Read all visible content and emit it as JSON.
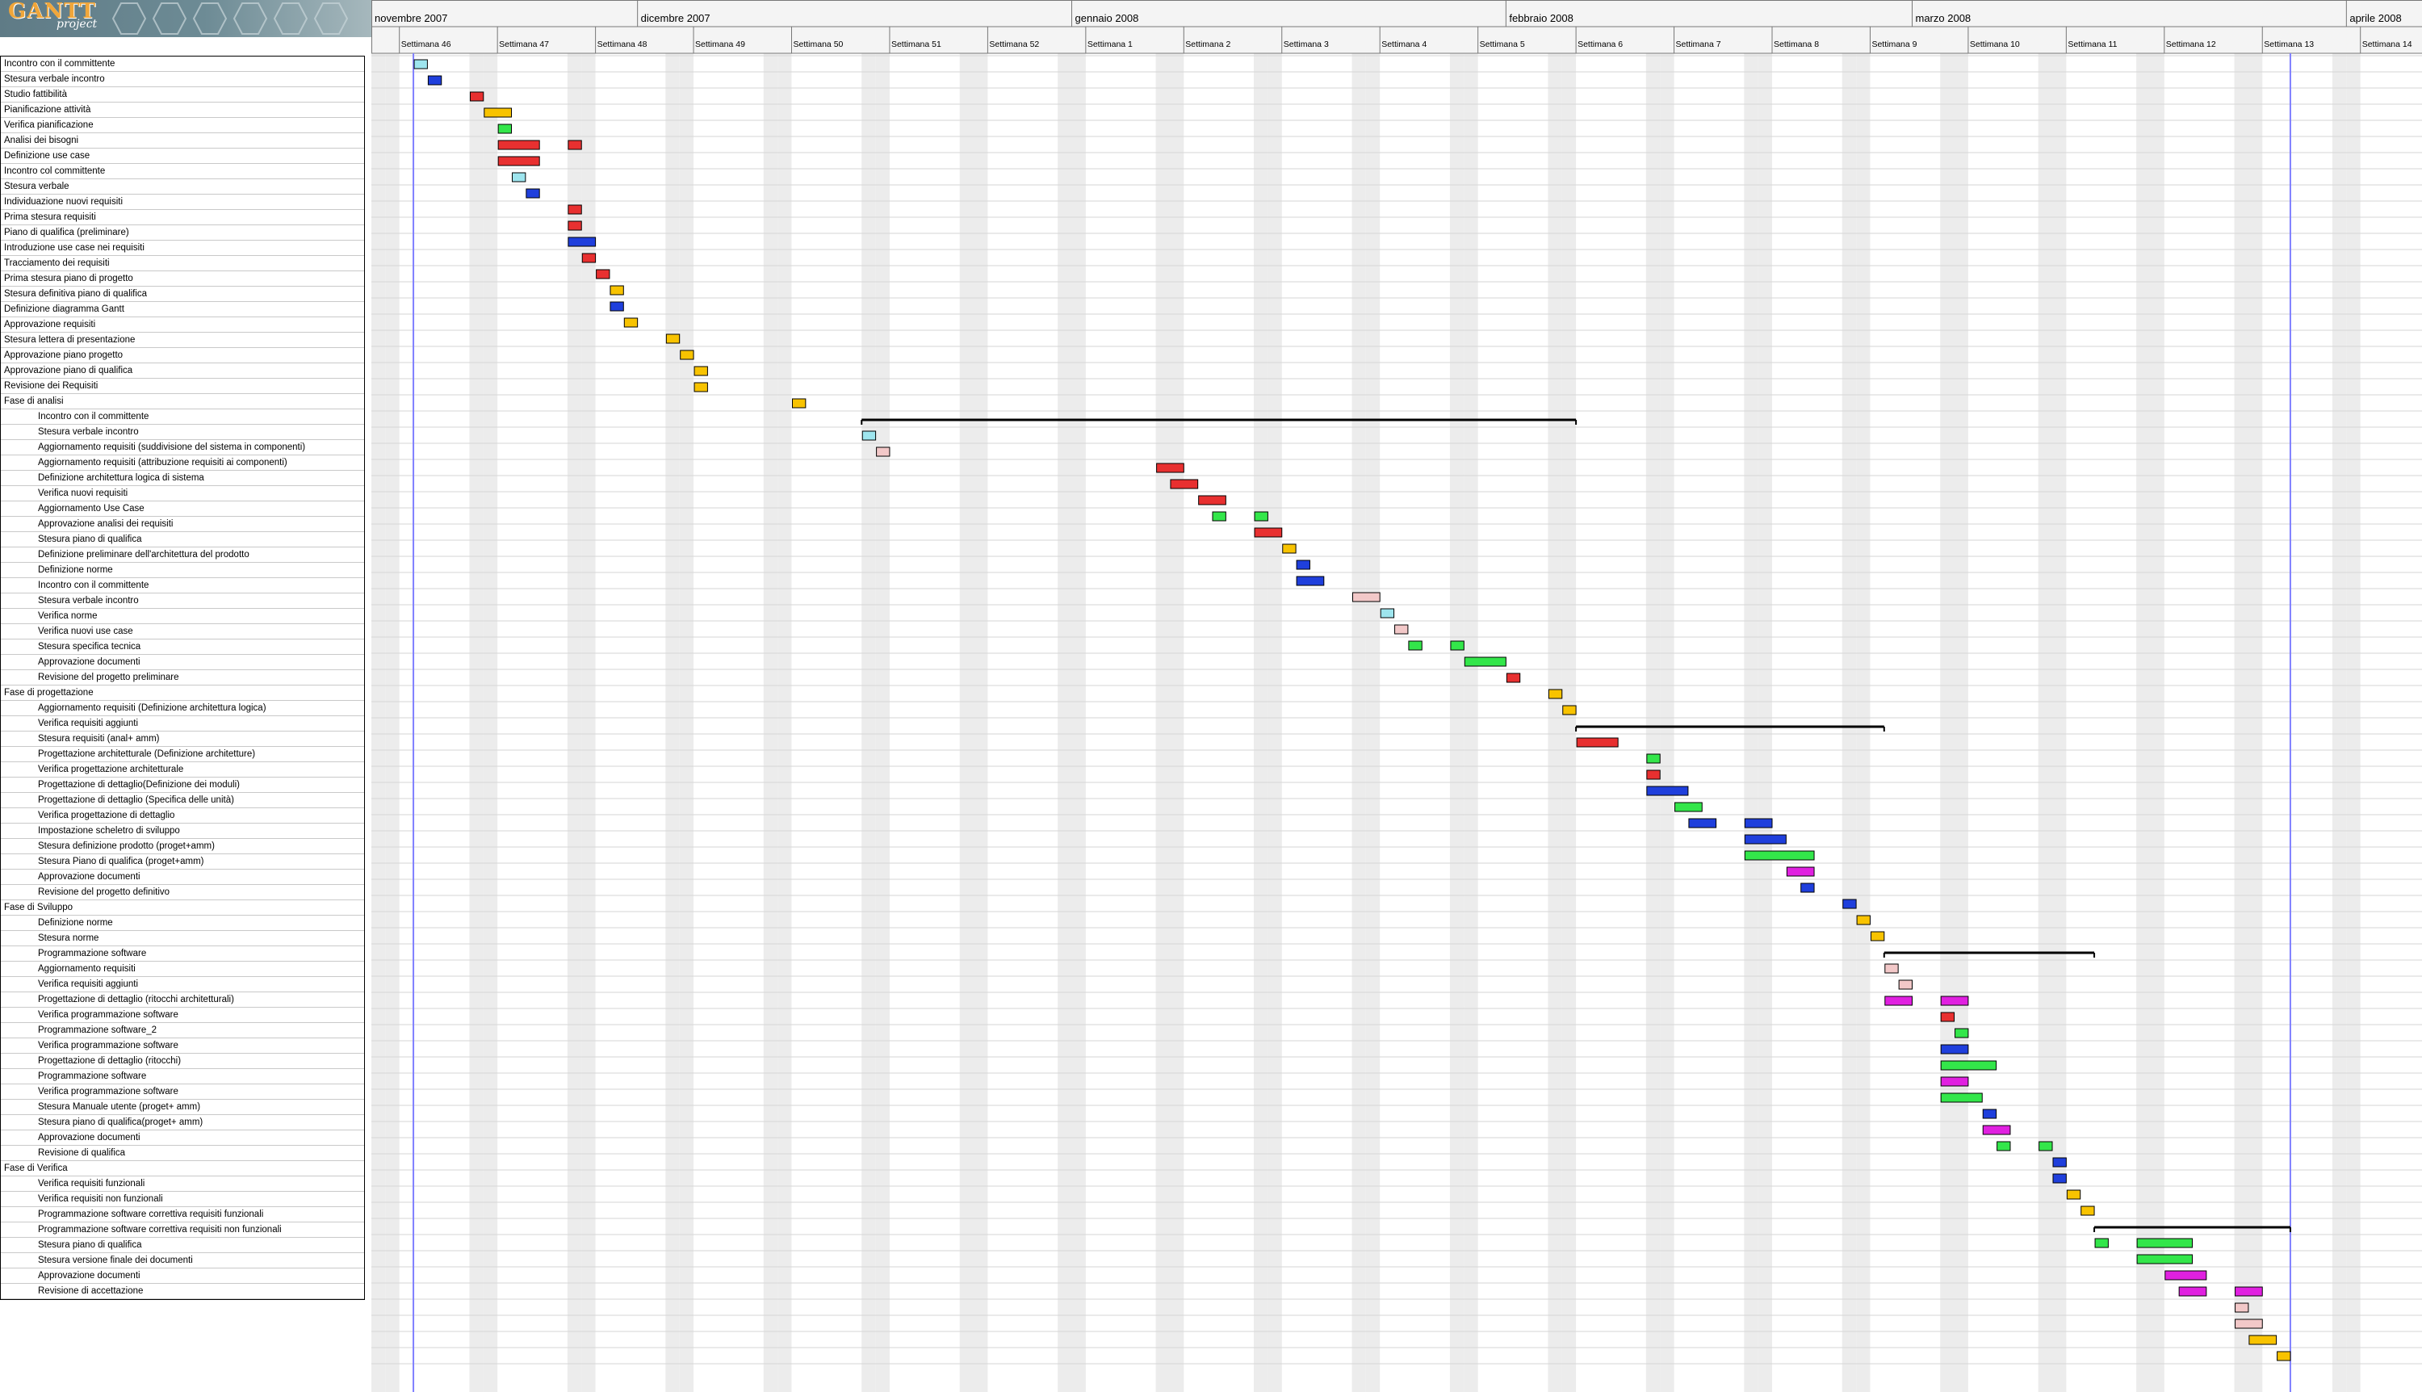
{
  "app": {
    "logo_text": "GANTT",
    "logo_sub": "project"
  },
  "colors": {
    "cyan": "#9ee5ee",
    "blue": "#1f3fdc",
    "red": "#e83030",
    "yellow": "#f8c300",
    "green": "#33e64a",
    "pink": "#f2c8c8",
    "magenta": "#e020e0",
    "weekend": "#ececec",
    "today_line": "#8080ff"
  },
  "timeline": {
    "months": [
      {
        "label": "novembre 2007"
      },
      {
        "label": "dicembre 2007"
      },
      {
        "label": "gennaio 2008"
      },
      {
        "label": "febbraio 2008"
      },
      {
        "label": "marzo 2008"
      },
      {
        "label": "aprile 2008"
      }
    ],
    "weeks": [
      "Settimana 46",
      "Settimana 47",
      "Settimana 48",
      "Settimana 49",
      "Settimana 50",
      "Settimana 51",
      "Settimana 52",
      "Settimana 1",
      "Settimana 2",
      "Settimana 3",
      "Settimana 4",
      "Settimana 5",
      "Settimana 6",
      "Settimana 7",
      "Settimana 8",
      "Settimana 9",
      "Settimana 10",
      "Settimana 11",
      "Settimana 12",
      "Settimana 13",
      "Settimana 14"
    ]
  },
  "tasks": [
    {
      "name": "Incontro con il committente",
      "level": 1,
      "bars": [
        {
          "s": 3,
          "e": 4,
          "c": "cyan"
        }
      ]
    },
    {
      "name": "Stesura verbale incontro",
      "level": 1,
      "bars": [
        {
          "s": 4,
          "e": 5,
          "c": "blue"
        }
      ]
    },
    {
      "name": "Studio fattibilità",
      "level": 1,
      "bars": [
        {
          "s": 7,
          "e": 8,
          "c": "red"
        }
      ]
    },
    {
      "name": "Pianificazione attività",
      "level": 1,
      "bars": [
        {
          "s": 8,
          "e": 10,
          "c": "yellow"
        }
      ]
    },
    {
      "name": "Verifica pianificazione",
      "level": 1,
      "bars": [
        {
          "s": 9,
          "e": 10,
          "c": "green"
        }
      ]
    },
    {
      "name": "Analisi dei bisogni",
      "level": 1,
      "bars": [
        {
          "s": 9,
          "e": 12,
          "c": "red"
        },
        {
          "s": 14,
          "e": 15,
          "c": "red"
        }
      ]
    },
    {
      "name": "Definizione use case",
      "level": 1,
      "bars": [
        {
          "s": 9,
          "e": 12,
          "c": "red"
        }
      ]
    },
    {
      "name": "Incontro col committente",
      "level": 1,
      "bars": [
        {
          "s": 10,
          "e": 11,
          "c": "cyan"
        }
      ]
    },
    {
      "name": "Stesura verbale",
      "level": 1,
      "bars": [
        {
          "s": 11,
          "e": 12,
          "c": "blue"
        }
      ]
    },
    {
      "name": "Individuazione nuovi requisiti",
      "level": 1,
      "bars": [
        {
          "s": 14,
          "e": 15,
          "c": "red"
        }
      ]
    },
    {
      "name": "Prima stesura requisiti",
      "level": 1,
      "bars": [
        {
          "s": 14,
          "e": 15,
          "c": "red"
        }
      ]
    },
    {
      "name": "Piano di qualifica (preliminare)",
      "level": 1,
      "bars": [
        {
          "s": 14,
          "e": 16,
          "c": "blue"
        }
      ]
    },
    {
      "name": "Introduzione use case nei requisiti",
      "level": 1,
      "bars": [
        {
          "s": 15,
          "e": 16,
          "c": "red"
        }
      ]
    },
    {
      "name": "Tracciamento dei requisiti",
      "level": 1,
      "bars": [
        {
          "s": 16,
          "e": 17,
          "c": "red"
        }
      ]
    },
    {
      "name": "Prima stesura piano di progetto",
      "level": 1,
      "bars": [
        {
          "s": 17,
          "e": 18,
          "c": "yellow"
        }
      ]
    },
    {
      "name": "Stesura definitiva piano di qualifica",
      "level": 1,
      "bars": [
        {
          "s": 17,
          "e": 18,
          "c": "blue"
        }
      ]
    },
    {
      "name": "Definizione diagramma Gantt",
      "level": 1,
      "bars": [
        {
          "s": 18,
          "e": 19,
          "c": "yellow"
        }
      ]
    },
    {
      "name": "Approvazione requisiti",
      "level": 1,
      "bars": [
        {
          "s": 21,
          "e": 22,
          "c": "yellow"
        }
      ]
    },
    {
      "name": "Stesura lettera di presentazione",
      "level": 1,
      "bars": [
        {
          "s": 22,
          "e": 23,
          "c": "yellow"
        }
      ]
    },
    {
      "name": "Approvazione piano progetto",
      "level": 1,
      "bars": [
        {
          "s": 23,
          "e": 24,
          "c": "yellow"
        }
      ]
    },
    {
      "name": "Approvazione piano di qualifica",
      "level": 1,
      "bars": [
        {
          "s": 23,
          "e": 24,
          "c": "yellow"
        }
      ]
    },
    {
      "name": "Revisione dei Requisiti",
      "level": 1,
      "bars": [
        {
          "s": 30,
          "e": 31,
          "c": "yellow"
        }
      ]
    },
    {
      "name": "Fase di analisi",
      "level": 1,
      "summary": {
        "s": 35,
        "e": 86
      }
    },
    {
      "name": "Incontro con il committente",
      "level": 2,
      "bars": [
        {
          "s": 35,
          "e": 36,
          "c": "cyan"
        }
      ]
    },
    {
      "name": "Stesura verbale incontro",
      "level": 2,
      "bars": [
        {
          "s": 36,
          "e": 37,
          "c": "pink"
        }
      ]
    },
    {
      "name": "Aggiornamento requisiti (suddivisione del sistema in componenti)",
      "level": 2,
      "bars": [
        {
          "s": 56,
          "e": 58,
          "c": "red"
        }
      ]
    },
    {
      "name": "Aggiornamento requisiti (attribuzione requisiti ai componenti)",
      "level": 2,
      "bars": [
        {
          "s": 57,
          "e": 59,
          "c": "red"
        }
      ]
    },
    {
      "name": "Definizione architettura logica di sistema",
      "level": 2,
      "bars": [
        {
          "s": 59,
          "e": 61,
          "c": "red"
        }
      ]
    },
    {
      "name": "Verifica nuovi requisiti",
      "level": 2,
      "bars": [
        {
          "s": 60,
          "e": 61,
          "c": "green"
        },
        {
          "s": 63,
          "e": 64,
          "c": "green"
        }
      ]
    },
    {
      "name": "Aggiornamento Use Case",
      "level": 2,
      "bars": [
        {
          "s": 63,
          "e": 65,
          "c": "red"
        }
      ]
    },
    {
      "name": "Approvazione analisi dei requisiti",
      "level": 2,
      "bars": [
        {
          "s": 65,
          "e": 66,
          "c": "yellow"
        }
      ]
    },
    {
      "name": "Stesura piano di qualifica",
      "level": 2,
      "bars": [
        {
          "s": 66,
          "e": 67,
          "c": "blue"
        }
      ]
    },
    {
      "name": "Definizione preliminare dell'architettura del prodotto",
      "level": 2,
      "bars": [
        {
          "s": 66,
          "e": 68,
          "c": "blue"
        }
      ]
    },
    {
      "name": "Definizione norme",
      "level": 2,
      "bars": [
        {
          "s": 70,
          "e": 72,
          "c": "pink"
        }
      ]
    },
    {
      "name": "Incontro con il committente",
      "level": 2,
      "bars": [
        {
          "s": 72,
          "e": 73,
          "c": "cyan"
        }
      ]
    },
    {
      "name": "Stesura verbale incontro",
      "level": 2,
      "bars": [
        {
          "s": 73,
          "e": 74,
          "c": "pink"
        }
      ]
    },
    {
      "name": "Verifica norme",
      "level": 2,
      "bars": [
        {
          "s": 74,
          "e": 75,
          "c": "green"
        },
        {
          "s": 77,
          "e": 78,
          "c": "green"
        }
      ]
    },
    {
      "name": "Verifica nuovi use case",
      "level": 2,
      "bars": [
        {
          "s": 78,
          "e": 81,
          "c": "green"
        }
      ]
    },
    {
      "name": "Stesura specifica tecnica",
      "level": 2,
      "bars": [
        {
          "s": 81,
          "e": 82,
          "c": "red"
        }
      ]
    },
    {
      "name": "Approvazione documenti",
      "level": 2,
      "bars": [
        {
          "s": 84,
          "e": 85,
          "c": "yellow"
        }
      ]
    },
    {
      "name": "Revisione del progetto preliminare",
      "level": 2,
      "bars": [
        {
          "s": 85,
          "e": 86,
          "c": "yellow"
        }
      ]
    },
    {
      "name": "Fase di progettazione",
      "level": 1,
      "summary": {
        "s": 86,
        "e": 108
      }
    },
    {
      "name": "Aggiornamento requisiti (Definizione architettura logica)",
      "level": 2,
      "bars": [
        {
          "s": 86,
          "e": 89,
          "c": "red"
        }
      ]
    },
    {
      "name": "Verifica requisiti aggiunti",
      "level": 2,
      "bars": [
        {
          "s": 91,
          "e": 92,
          "c": "green"
        }
      ]
    },
    {
      "name": "Stesura requisiti (anal+ amm)",
      "level": 2,
      "bars": [
        {
          "s": 91,
          "e": 92,
          "c": "red"
        }
      ]
    },
    {
      "name": "Progettazione architetturale (Definizione architetture)",
      "level": 2,
      "bars": [
        {
          "s": 91,
          "e": 94,
          "c": "blue"
        }
      ]
    },
    {
      "name": "Verifica progettazione architetturale",
      "level": 2,
      "bars": [
        {
          "s": 93,
          "e": 95,
          "c": "green"
        }
      ]
    },
    {
      "name": "Progettazione di dettaglio(Definizione dei moduli)",
      "level": 2,
      "bars": [
        {
          "s": 94,
          "e": 96,
          "c": "blue"
        },
        {
          "s": 98,
          "e": 100,
          "c": "blue"
        }
      ]
    },
    {
      "name": "Progettazione di dettaglio (Specifica delle unità)",
      "level": 2,
      "bars": [
        {
          "s": 98,
          "e": 101,
          "c": "blue"
        }
      ]
    },
    {
      "name": "Verifica progettazione di dettaglio",
      "level": 2,
      "bars": [
        {
          "s": 98,
          "e": 103,
          "c": "green"
        }
      ]
    },
    {
      "name": "Impostazione scheletro di sviluppo",
      "level": 2,
      "bars": [
        {
          "s": 101,
          "e": 103,
          "c": "magenta"
        }
      ]
    },
    {
      "name": "Stesura definizione prodotto (proget+amm)",
      "level": 2,
      "bars": [
        {
          "s": 102,
          "e": 103,
          "c": "blue"
        }
      ]
    },
    {
      "name": "Stesura Piano di qualifica (proget+amm)",
      "level": 2,
      "bars": [
        {
          "s": 105,
          "e": 106,
          "c": "blue"
        }
      ]
    },
    {
      "name": "Approvazione documenti",
      "level": 2,
      "bars": [
        {
          "s": 106,
          "e": 107,
          "c": "yellow"
        }
      ]
    },
    {
      "name": "Revisione del progetto definitivo",
      "level": 2,
      "bars": [
        {
          "s": 107,
          "e": 108,
          "c": "yellow"
        }
      ]
    },
    {
      "name": "Fase di Sviluppo",
      "level": 1,
      "summary": {
        "s": 108,
        "e": 123
      }
    },
    {
      "name": "Definizione norme",
      "level": 2,
      "bars": [
        {
          "s": 108,
          "e": 109,
          "c": "pink"
        }
      ]
    },
    {
      "name": "Stesura norme",
      "level": 2,
      "bars": [
        {
          "s": 109,
          "e": 110,
          "c": "pink"
        }
      ]
    },
    {
      "name": "Programmazione software",
      "level": 2,
      "bars": [
        {
          "s": 108,
          "e": 110,
          "c": "magenta"
        },
        {
          "s": 112,
          "e": 114,
          "c": "magenta"
        }
      ]
    },
    {
      "name": "Aggiornamento requisiti",
      "level": 2,
      "bars": [
        {
          "s": 112,
          "e": 113,
          "c": "red"
        }
      ]
    },
    {
      "name": "Verifica requisiti aggiunti",
      "level": 2,
      "bars": [
        {
          "s": 113,
          "e": 114,
          "c": "green"
        }
      ]
    },
    {
      "name": "Progettazione di dettaglio (ritocchi architetturali)",
      "level": 2,
      "bars": [
        {
          "s": 112,
          "e": 114,
          "c": "blue"
        }
      ]
    },
    {
      "name": "Verifica programmazione software",
      "level": 2,
      "bars": [
        {
          "s": 112,
          "e": 116,
          "c": "green"
        }
      ]
    },
    {
      "name": "Programmazione software_2",
      "level": 2,
      "bars": [
        {
          "s": 112,
          "e": 114,
          "c": "magenta"
        }
      ]
    },
    {
      "name": "Verifica programmazione software",
      "level": 2,
      "bars": [
        {
          "s": 112,
          "e": 115,
          "c": "green"
        }
      ]
    },
    {
      "name": "Progettazione di dettaglio (ritocchi)",
      "level": 2,
      "bars": [
        {
          "s": 115,
          "e": 116,
          "c": "blue"
        }
      ]
    },
    {
      "name": "Programmazione software",
      "level": 2,
      "bars": [
        {
          "s": 115,
          "e": 117,
          "c": "magenta"
        }
      ]
    },
    {
      "name": "Verifica programmazione software",
      "level": 2,
      "bars": [
        {
          "s": 116,
          "e": 117,
          "c": "green"
        },
        {
          "s": 119,
          "e": 120,
          "c": "green"
        }
      ]
    },
    {
      "name": "Stesura Manuale utente (proget+ amm)",
      "level": 2,
      "bars": [
        {
          "s": 120,
          "e": 121,
          "c": "blue"
        }
      ]
    },
    {
      "name": "Stesura piano di qualifica(proget+ amm)",
      "level": 2,
      "bars": [
        {
          "s": 120,
          "e": 121,
          "c": "blue"
        }
      ]
    },
    {
      "name": "Approvazione documenti",
      "level": 2,
      "bars": [
        {
          "s": 121,
          "e": 122,
          "c": "yellow"
        }
      ]
    },
    {
      "name": "Revisione di qualifica",
      "level": 2,
      "bars": [
        {
          "s": 122,
          "e": 123,
          "c": "yellow"
        }
      ]
    },
    {
      "name": "Fase di Verifica",
      "level": 1,
      "summary": {
        "s": 123,
        "e": 137
      }
    },
    {
      "name": "Verifica requisiti funzionali",
      "level": 2,
      "bars": [
        {
          "s": 123,
          "e": 124,
          "c": "green"
        },
        {
          "s": 126,
          "e": 130,
          "c": "green"
        }
      ]
    },
    {
      "name": "Verifica requisiti non funzionali",
      "level": 2,
      "bars": [
        {
          "s": 126,
          "e": 130,
          "c": "green"
        }
      ]
    },
    {
      "name": "Programmazione software correttiva requisiti funzionali",
      "level": 2,
      "bars": [
        {
          "s": 128,
          "e": 131,
          "c": "magenta"
        }
      ]
    },
    {
      "name": "Programmazione software correttiva requisiti non funzionali",
      "level": 2,
      "bars": [
        {
          "s": 129,
          "e": 131,
          "c": "magenta"
        },
        {
          "s": 133,
          "e": 135,
          "c": "magenta"
        }
      ]
    },
    {
      "name": "Stesura piano di qualifica",
      "level": 2,
      "bars": [
        {
          "s": 133,
          "e": 134,
          "c": "pink"
        }
      ]
    },
    {
      "name": "Stesura versione finale dei documenti",
      "level": 2,
      "bars": [
        {
          "s": 133,
          "e": 135,
          "c": "pink"
        }
      ]
    },
    {
      "name": "Approvazione documenti",
      "level": 2,
      "bars": [
        {
          "s": 134,
          "e": 136,
          "c": "yellow"
        }
      ]
    },
    {
      "name": "Revisione di accettazione",
      "level": 2,
      "bars": [
        {
          "s": 136,
          "e": 137,
          "c": "yellow"
        }
      ]
    }
  ]
}
